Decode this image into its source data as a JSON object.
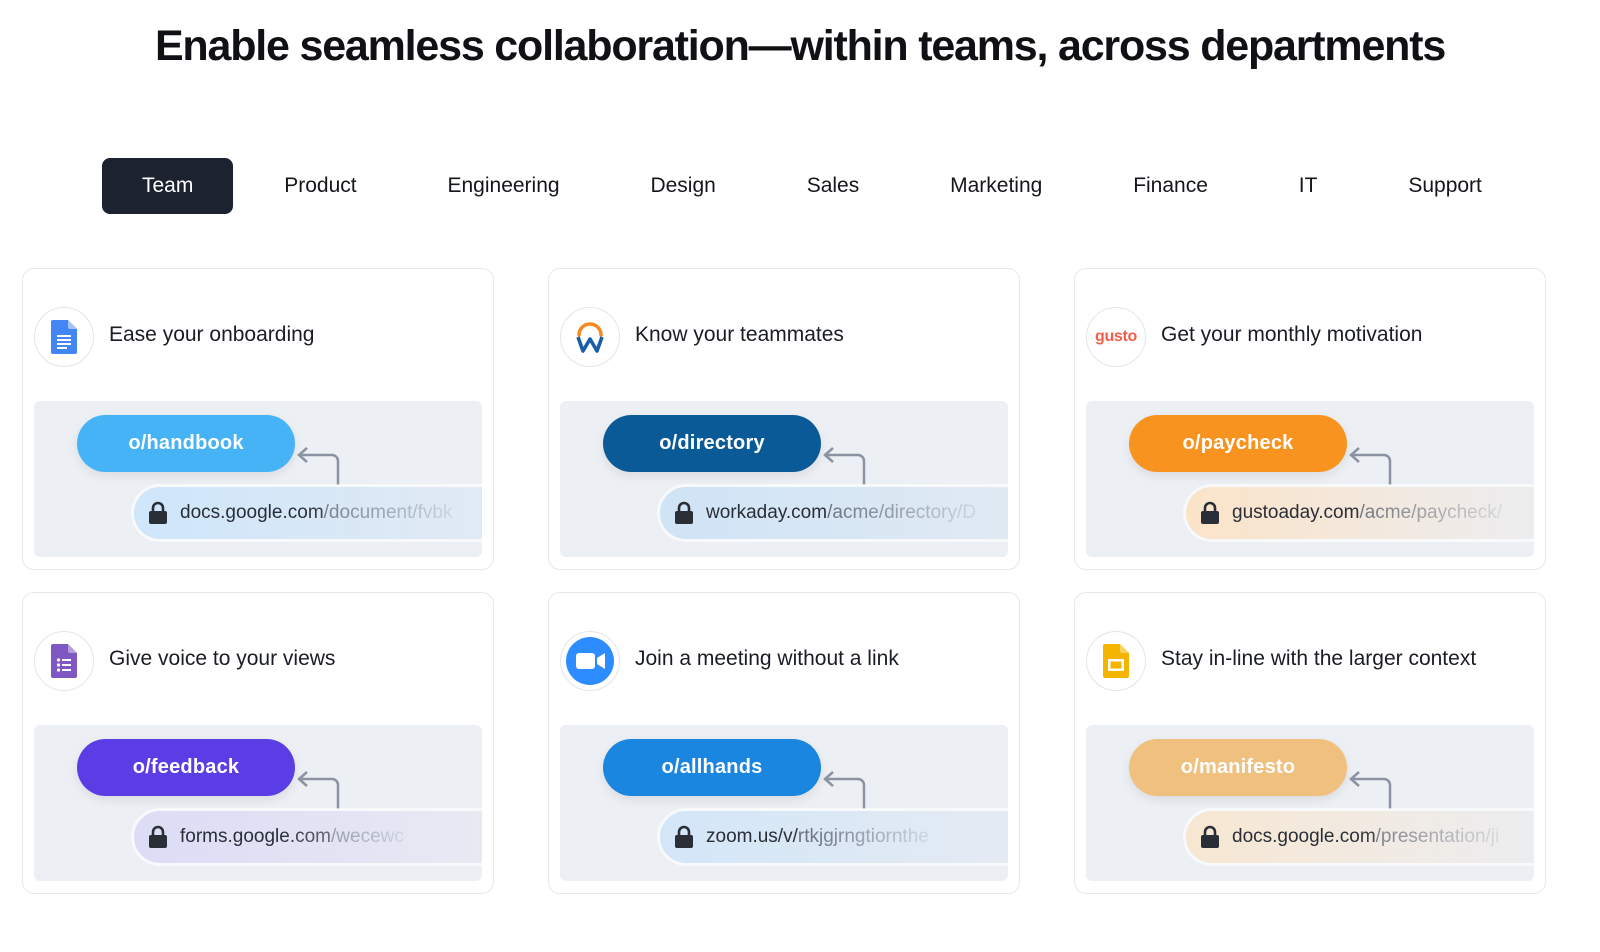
{
  "headline": "Enable seamless collaboration—within teams, across departments",
  "tabs": [
    {
      "label": "Team",
      "active": true
    },
    {
      "label": "Product"
    },
    {
      "label": "Engineering"
    },
    {
      "label": "Design"
    },
    {
      "label": "Sales"
    },
    {
      "label": "Marketing"
    },
    {
      "label": "Finance"
    },
    {
      "label": "IT"
    },
    {
      "label": "Support"
    }
  ],
  "cards": [
    {
      "title": "Ease your onboarding",
      "icon": "google-docs-icon",
      "golink": "o/handbook",
      "golink_color": "#45b3f5",
      "url_host": "docs.google.com",
      "url_path": "/document/fvbk",
      "url_bg": "#cfe6fb"
    },
    {
      "title": "Know your teammates",
      "icon": "workday-logo-icon",
      "golink": "o/directory",
      "golink_color": "#0b5a98",
      "url_host": "workaday.com",
      "url_path": "/acme/directory/D",
      "url_bg": "#cfe4f6"
    },
    {
      "title": "Get your monthly motivation",
      "icon": "gusto-logo-icon",
      "logo_text": "gusto",
      "golink": "o/paycheck",
      "golink_color": "#f7931e",
      "url_host": "gustoaday.com",
      "url_path": "/acme/paycheck/",
      "url_bg": "#fbe3c8"
    },
    {
      "title": "Give voice to your views",
      "icon": "google-forms-icon",
      "golink": "o/feedback",
      "golink_color": "#5b3de6",
      "url_host": "forms.google.com",
      "url_path": "/wecewc",
      "url_bg": "#dcdcf6"
    },
    {
      "title": "Join a meeting without a link",
      "icon": "zoom-icon",
      "golink": "o/allhands",
      "golink_color": "#1a86e0",
      "url_host": "zoom.us/v/",
      "url_path": "rtkjgjrngtiornthe",
      "url_bg": "#d3e6f8"
    },
    {
      "title": "Stay in-line with the larger context",
      "icon": "google-slides-icon",
      "golink": "o/manifesto",
      "golink_color": "#f0c07e",
      "url_host": "docs.google.com",
      "url_path": "/presentation/ji",
      "url_bg": "#f7e7d2"
    }
  ]
}
